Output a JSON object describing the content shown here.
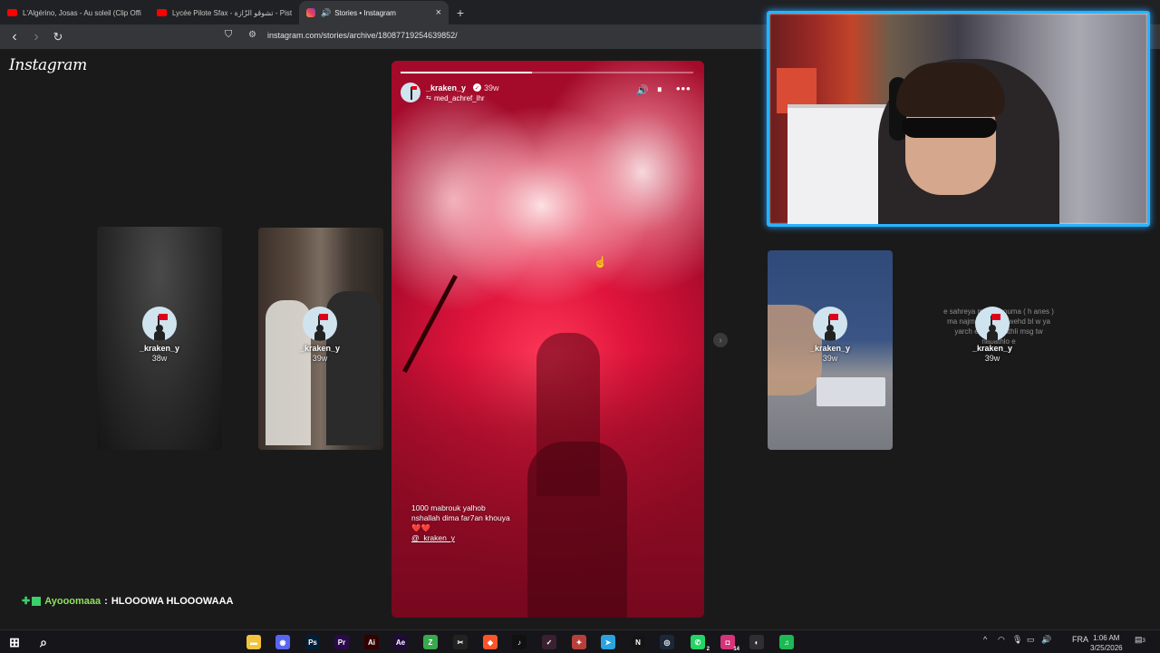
{
  "browser": {
    "tabs": [
      {
        "label": "L'Algérino, Josas - Au soleil (Clip Offi",
        "icon": "youtube-icon",
        "active": false
      },
      {
        "label": "Lycée Pilote Sfax - تشوڨو الزّازة - Pist",
        "icon": "youtube-icon",
        "active": false
      },
      {
        "label": "Stories • Instagram",
        "icon": "instagram-icon",
        "active": true,
        "close": "×"
      }
    ],
    "new_tab": "+",
    "back": "‹",
    "forward": "›",
    "reload": "↻",
    "bookmark": "⛉",
    "url": "instagram.com/stories/archive/18087719254639852/"
  },
  "instagram": {
    "logo": "Instagram",
    "side_stories": [
      {
        "user": "_kraken_y",
        "time": "38w"
      },
      {
        "user": "_kraken_y",
        "time": "39w"
      },
      {
        "user": "_kraken_y",
        "time": "39w"
      },
      {
        "user": "_kraken_y",
        "time": "39w",
        "caption": "e sahreya m3a fi houma ( h anes ) ma najmch td3a bl wehd bl w ya yarch e dar yabathli msg tw nabathlo e"
      }
    ],
    "next_arrow": "›",
    "main_story": {
      "user": "_kraken_y",
      "verified": "✓",
      "time": "39w",
      "collab_user": "med_achref_lhr",
      "progress": 0.45,
      "controls": {
        "sound": "🔊",
        "pause": "⏸",
        "more": "•••"
      },
      "caption_line1": "1000 mabrouk yalhob nshallah dima far7an khouya",
      "caption_hearts": "❤️❤️",
      "caption_mention": "@_kraken_y"
    },
    "cursor": "☝"
  },
  "chat": {
    "name": "Ayooomaaa",
    "separator": ":",
    "message": "HLOOOWA HLOOOWAAA"
  },
  "taskbar": {
    "apps": [
      {
        "name": "start-icon",
        "label": "⊞",
        "color": "#ffffff"
      },
      {
        "name": "search-icon",
        "label": "⌕",
        "color": "#ffffff"
      },
      {
        "name": "file-explorer-icon",
        "label": "▬",
        "color": "#f3c33b"
      },
      {
        "name": "discord-icon",
        "label": "◉",
        "color": "#5865f2"
      },
      {
        "name": "photoshop-icon",
        "label": "Ps",
        "color": "#001e36"
      },
      {
        "name": "premiere-icon",
        "label": "Pr",
        "color": "#2a0a4a"
      },
      {
        "name": "illustrator-icon",
        "label": "Ai",
        "color": "#330000"
      },
      {
        "name": "after-effects-icon",
        "label": "Ae",
        "color": "#1f0a3a"
      },
      {
        "name": "app-green-icon",
        "label": "Z",
        "color": "#3aa84e"
      },
      {
        "name": "capcut-icon",
        "label": "✂",
        "color": "#222222"
      },
      {
        "name": "brave-icon",
        "label": "◆",
        "color": "#fb542b"
      },
      {
        "name": "tiktok-icon",
        "label": "♪",
        "color": "#111111"
      },
      {
        "name": "app-dark-icon",
        "label": "✓",
        "color": "#3a2030"
      },
      {
        "name": "game-icon",
        "label": "✦",
        "color": "#b8403a"
      },
      {
        "name": "telegram-icon",
        "label": "➤",
        "color": "#2aa3df"
      },
      {
        "name": "netflix-icon",
        "label": "N",
        "color": "#141414"
      },
      {
        "name": "steam-icon",
        "label": "◎",
        "color": "#1b2838"
      },
      {
        "name": "whatsapp-icon",
        "label": "✆",
        "color": "#25d366",
        "badge": "2"
      },
      {
        "name": "instagram-taskbar-icon",
        "label": "◘",
        "color": "#d6337a",
        "badge": "14"
      },
      {
        "name": "obs-icon",
        "label": "◐",
        "color": "#302e31"
      },
      {
        "name": "spotify-icon",
        "label": "♫",
        "color": "#1db954"
      }
    ],
    "tray": {
      "chevron": "^",
      "wifi": "◠",
      "mic": "🎙",
      "battery": "▭",
      "volume": "🔊",
      "notifications_count": "3",
      "lang": "FRA"
    },
    "time": "1:06 AM",
    "date": "3/25/2026"
  }
}
